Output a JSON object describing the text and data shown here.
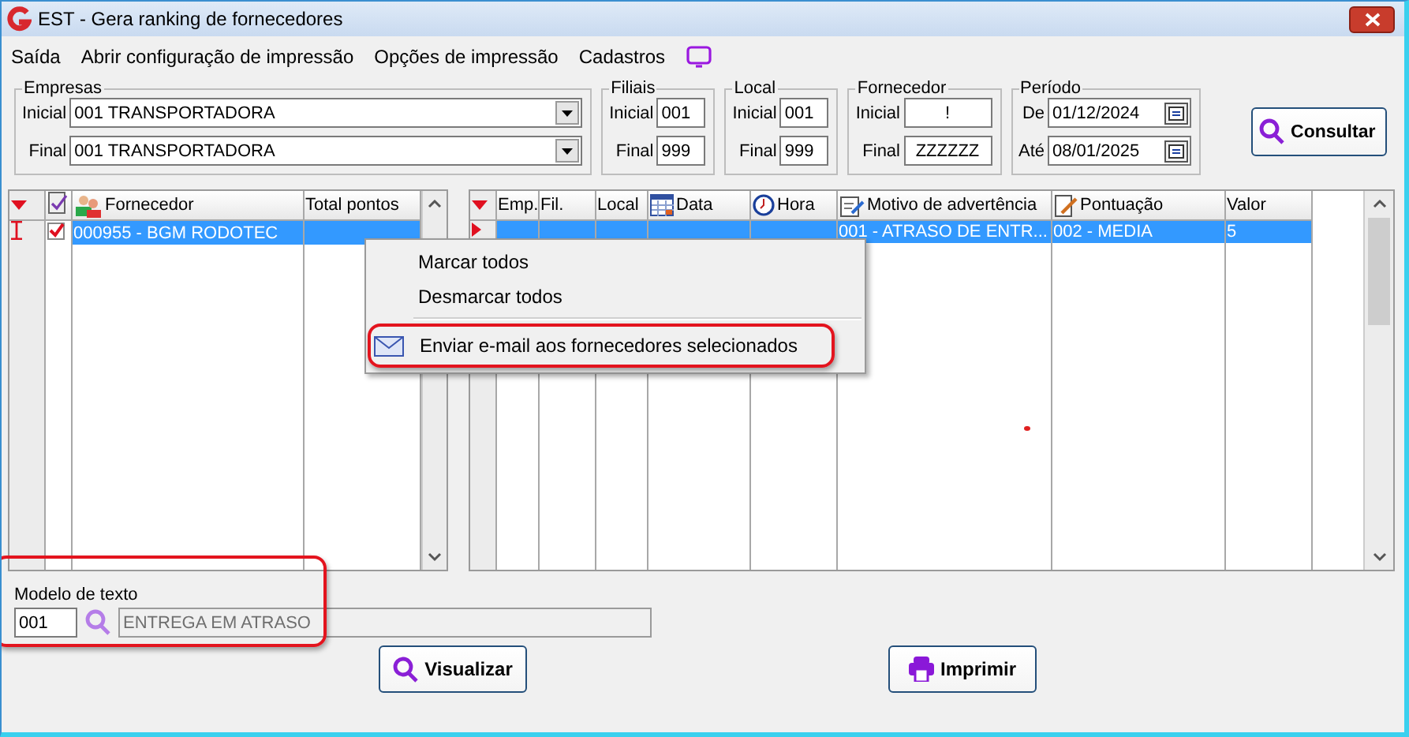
{
  "window": {
    "title": "EST - Gera ranking de fornecedores"
  },
  "menu_bar": [
    {
      "label": "Saída"
    },
    {
      "label": "Abrir configuração de impressão"
    },
    {
      "label": "Opções de impressão"
    },
    {
      "label": "Cadastros"
    }
  ],
  "filter_groups": [
    {
      "title": "Empresas",
      "kind": "combo",
      "fields": [
        {
          "label": "Inicial",
          "value": "001 TRANSPORTADORA"
        },
        {
          "label": "Final",
          "value": "001 TRANSPORTADORA"
        }
      ]
    },
    {
      "title": "Filiais",
      "kind": "text",
      "fields": [
        {
          "label": "Inicial",
          "value": "001"
        },
        {
          "label": "Final",
          "value": "999"
        }
      ]
    },
    {
      "title": "Local",
      "kind": "text",
      "fields": [
        {
          "label": "Inicial",
          "value": "001"
        },
        {
          "label": "Final",
          "value": "999"
        }
      ]
    },
    {
      "title": "Fornecedor",
      "kind": "wide",
      "fields": [
        {
          "label": "Inicial",
          "value": "!"
        },
        {
          "label": "Final",
          "value": "ZZZZZZ"
        }
      ]
    },
    {
      "title": "Período",
      "kind": "date",
      "fields": [
        {
          "label": "De",
          "value": "01/12/2024"
        },
        {
          "label": "Até",
          "value": "08/01/2025"
        }
      ]
    }
  ],
  "search_button": {
    "label": "Consultar"
  },
  "supplier_grid": {
    "columns": [
      {
        "label": "Fornecedor",
        "kind": "people"
      },
      {
        "label": "Total pontos",
        "kind": "plain"
      }
    ],
    "rows": [
      {
        "selected": true,
        "checked": true,
        "cells": [
          "000955 - BGM RODOTEC",
          ""
        ]
      }
    ]
  },
  "detail_grid": {
    "columns": [
      {
        "label": "Emp.",
        "kind": "plain"
      },
      {
        "label": "Fil.",
        "kind": "plain"
      },
      {
        "label": "Local",
        "kind": "plain"
      },
      {
        "label": "Data",
        "kind": "date"
      },
      {
        "label": "Hora",
        "kind": "time"
      },
      {
        "label": "Motivo de advertência",
        "kind": "note"
      },
      {
        "label": "Pontuação",
        "kind": "edit"
      },
      {
        "label": "Valor",
        "kind": "plain"
      }
    ],
    "rows": [
      {
        "selected": true,
        "cells": [
          "",
          "",
          "",
          "",
          "",
          "001 - ATRASO DE ENTR...",
          "002 - MEDIA",
          "5"
        ]
      }
    ]
  },
  "context_menu": [
    {
      "label": "Marcar todos",
      "kind": "plain",
      "highlighted": false
    },
    {
      "label": "Desmarcar todos",
      "kind": "plain",
      "highlighted": false
    },
    {
      "label": "Enviar e-mail aos fornecedores selecionados",
      "kind": "mail",
      "highlighted": true
    }
  ],
  "text_model": {
    "label": "Modelo de texto",
    "code": "001",
    "description": "ENTREGA EM ATRASO",
    "highlighted": true
  },
  "buttons": [
    {
      "label": "Visualizar",
      "kind": "view"
    },
    {
      "label": "Imprimir",
      "kind": "print"
    }
  ]
}
